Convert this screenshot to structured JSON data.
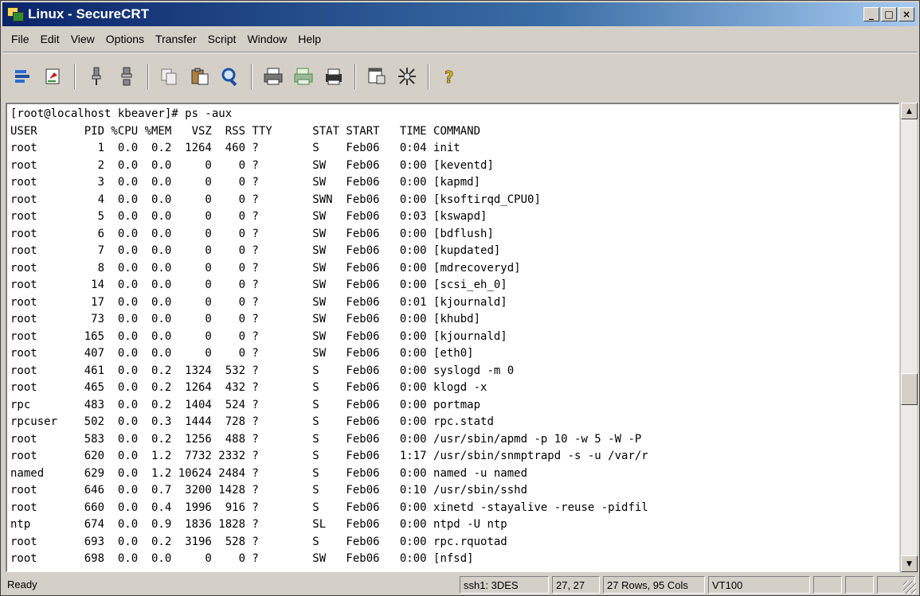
{
  "window": {
    "title": "Linux - SecureCRT",
    "buttons": {
      "minimize": "_",
      "maximize": "□",
      "close": "×"
    }
  },
  "menubar": {
    "items": [
      {
        "label": "File"
      },
      {
        "label": "Edit"
      },
      {
        "label": "View"
      },
      {
        "label": "Options"
      },
      {
        "label": "Transfer"
      },
      {
        "label": "Script"
      },
      {
        "label": "Window"
      },
      {
        "label": "Help"
      }
    ]
  },
  "toolbar": {
    "icons": [
      "connect-icon",
      "quick-connect-icon",
      "connect-in-tab-icon",
      "disconnect-icon",
      "copy-icon",
      "paste-icon",
      "find-icon",
      "print-icon",
      "print-selection-icon",
      "print-setup-icon",
      "session-options-icon",
      "global-options-icon",
      "help-icon"
    ]
  },
  "terminal": {
    "prompt": "[root@localhost kbeaver]# ps -aux",
    "header": "USER       PID %CPU %MEM   VSZ  RSS TTY      STAT START   TIME COMMAND",
    "lines": [
      "root         1  0.0  0.2  1264  460 ?        S    Feb06   0:04 init",
      "root         2  0.0  0.0     0    0 ?        SW   Feb06   0:00 [keventd]",
      "root         3  0.0  0.0     0    0 ?        SW   Feb06   0:00 [kapmd]",
      "root         4  0.0  0.0     0    0 ?        SWN  Feb06   0:00 [ksoftirqd_CPU0]",
      "root         5  0.0  0.0     0    0 ?        SW   Feb06   0:03 [kswapd]",
      "root         6  0.0  0.0     0    0 ?        SW   Feb06   0:00 [bdflush]",
      "root         7  0.0  0.0     0    0 ?        SW   Feb06   0:00 [kupdated]",
      "root         8  0.0  0.0     0    0 ?        SW   Feb06   0:00 [mdrecoveryd]",
      "root        14  0.0  0.0     0    0 ?        SW   Feb06   0:00 [scsi_eh_0]",
      "root        17  0.0  0.0     0    0 ?        SW   Feb06   0:01 [kjournald]",
      "root        73  0.0  0.0     0    0 ?        SW   Feb06   0:00 [khubd]",
      "root       165  0.0  0.0     0    0 ?        SW   Feb06   0:00 [kjournald]",
      "root       407  0.0  0.0     0    0 ?        SW   Feb06   0:00 [eth0]",
      "root       461  0.0  0.2  1324  532 ?        S    Feb06   0:00 syslogd -m 0",
      "root       465  0.0  0.2  1264  432 ?        S    Feb06   0:00 klogd -x",
      "rpc        483  0.0  0.2  1404  524 ?        S    Feb06   0:00 portmap",
      "rpcuser    502  0.0  0.3  1444  728 ?        S    Feb06   0:00 rpc.statd",
      "root       583  0.0  0.2  1256  488 ?        S    Feb06   0:00 /usr/sbin/apmd -p 10 -w 5 -W -P",
      "root       620  0.0  1.2  7732 2332 ?        S    Feb06   1:17 /usr/sbin/snmptrapd -s -u /var/r",
      "named      629  0.0  1.2 10624 2484 ?        S    Feb06   0:00 named -u named",
      "root       646  0.0  0.7  3200 1428 ?        S    Feb06   0:10 /usr/sbin/sshd",
      "root       660  0.0  0.4  1996  916 ?        S    Feb06   0:00 xinetd -stayalive -reuse -pidfil",
      "ntp        674  0.0  0.9  1836 1828 ?        SL   Feb06   0:00 ntpd -U ntp",
      "root       693  0.0  0.2  3196  528 ?        S    Feb06   0:00 rpc.rquotad",
      "root       698  0.0  0.0     0    0 ?        SW   Feb06   0:00 [nfsd]"
    ]
  },
  "statusbar": {
    "status": "Ready",
    "encryption": "ssh1: 3DES",
    "cursor": "27, 27",
    "size": "27 Rows, 95 Cols",
    "emulation": "VT100"
  },
  "colors": {
    "title_gradient_start": "#0a246a",
    "title_gradient_end": "#a6caf0",
    "chrome": "#d4d0c8",
    "terminal_bg": "#ffffff",
    "terminal_fg": "#000000"
  }
}
